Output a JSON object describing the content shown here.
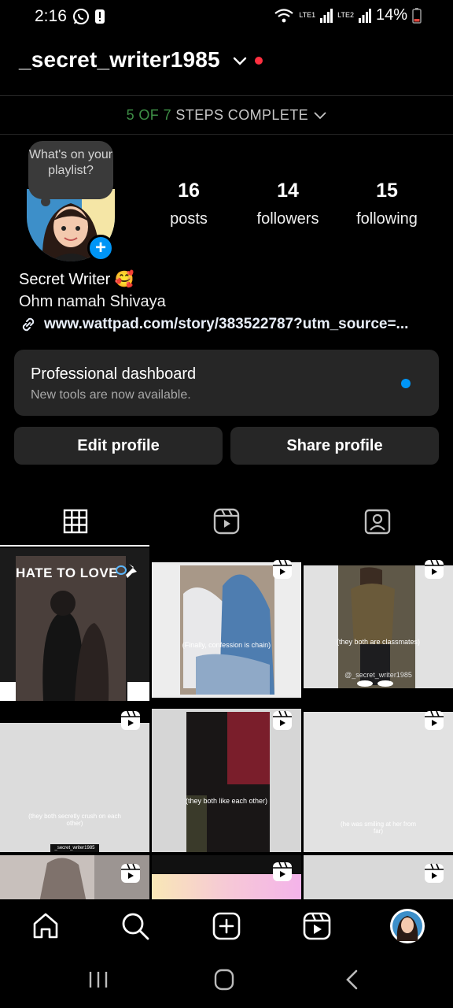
{
  "status_bar": {
    "time": "2:16",
    "lte1": "LTE1",
    "lte2": "LTE2",
    "battery": "14%"
  },
  "header": {
    "username": "_secret_writer1985"
  },
  "steps": {
    "progress": "5 OF 7",
    "label": "STEPS COMPLETE"
  },
  "note": {
    "text": "What's on your playlist?"
  },
  "stats": [
    {
      "value": "16",
      "label": "posts"
    },
    {
      "value": "14",
      "label": "followers"
    },
    {
      "value": "15",
      "label": "following"
    }
  ],
  "bio": {
    "name": "Secret Writer 🥰",
    "text": "Ohm namah Shivaya",
    "link": "www.wattpad.com/story/383522787?utm_source=..."
  },
  "dashboard": {
    "title": "Professional dashboard",
    "subtitle": "New tools are now available."
  },
  "buttons": {
    "edit": "Edit profile",
    "share": "Share profile"
  },
  "grid": {
    "tile1_text": "HATE TO LOVE",
    "tile2_caption": "(Finally, confession is chain)",
    "tile3_caption": "(they both are classmates)",
    "tile3_handle": "@_secret_writer1985",
    "tile5_caption": "(they both like each other)",
    "tile4_caption": "(they both secretly crush on each other)",
    "tile4_handle": "_secret_writer1985",
    "tile6_caption": "(he was smiling at her from far)"
  },
  "colors": {
    "accent_blue": "#0095f6",
    "notification_red": "#ff3040",
    "steps_green": "#3e8f46",
    "card_bg": "#262626"
  }
}
